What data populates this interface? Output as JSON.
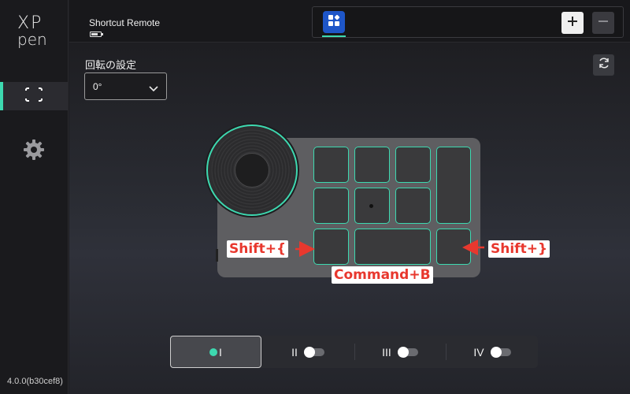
{
  "app": {
    "logo_text_top": "XP",
    "logo_text_bottom": "pen",
    "version": "4.0.0(b30cef8)"
  },
  "sidebar": {
    "items": [
      {
        "icon": "shortcut-keys-icon",
        "active": true
      },
      {
        "icon": "gear-icon",
        "active": false
      }
    ]
  },
  "header": {
    "device_name": "Shortcut Remote",
    "battery_icon": "battery-icon",
    "app_tab_icon": "app-grid-icon",
    "add_icon": "plus-icon",
    "remove_icon": "minus-icon"
  },
  "rotation": {
    "label": "回転の設定",
    "value": "0°"
  },
  "callouts": {
    "left": "Shift+{",
    "bottom": "Command+B",
    "right": "Shift+}"
  },
  "profiles": [
    {
      "label": "I",
      "active": true
    },
    {
      "label": "II",
      "active": false
    },
    {
      "label": "III",
      "active": false
    },
    {
      "label": "IV",
      "active": false
    }
  ],
  "colors": {
    "accent": "#3dd9b0",
    "callout": "#e8382e",
    "app_tab": "#1e56c8"
  }
}
